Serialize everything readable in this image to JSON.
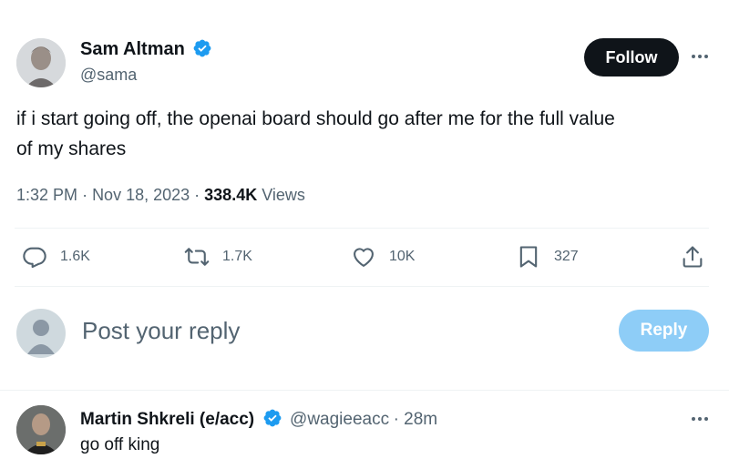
{
  "tweet": {
    "author_name": "Sam Altman",
    "author_handle": "@sama",
    "follow_label": "Follow",
    "text_line1": "if i start going off, the openai board should go after me for the full value",
    "text_line2": "of my shares",
    "time": "1:32 PM",
    "date": "Nov 18, 2023",
    "views_count": "338.4K",
    "views_label": "Views"
  },
  "actions": {
    "replies": "1.6K",
    "reposts": "1.7K",
    "likes": "10K",
    "bookmarks": "327"
  },
  "composer": {
    "placeholder": "Post your reply",
    "reply_label": "Reply"
  },
  "reply": {
    "author_name": "Martin Shkreli (e/acc)",
    "author_handle": "@wagieeacc",
    "time_ago": "28m",
    "text": "go off king"
  },
  "colors": {
    "verified": "#1d9bf0",
    "reply_button_disabled": "#8ecdf7",
    "text_primary": "#0f1419",
    "text_secondary": "#536471"
  }
}
